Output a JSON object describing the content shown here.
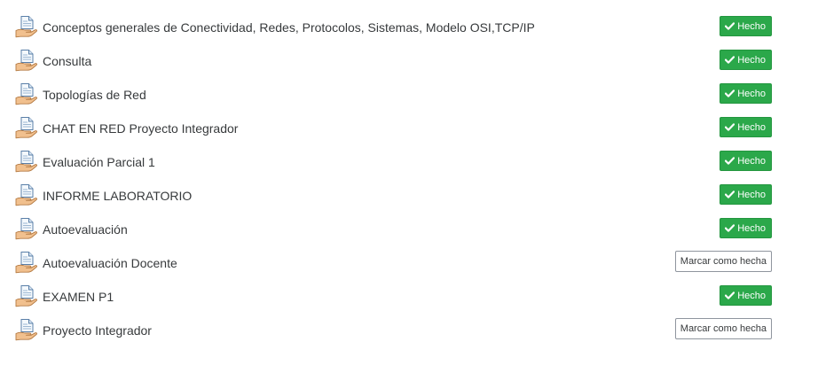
{
  "activities": [
    {
      "title": "Conceptos generales de Conectividad, Redes, Protocolos, Sistemas, Modelo OSI,TCP/IP",
      "status": "done",
      "status_label": "Hecho",
      "icon": "page-icon"
    },
    {
      "title": "Consulta",
      "status": "done",
      "status_label": "Hecho",
      "icon": "page-icon"
    },
    {
      "title": "Topologías de Red",
      "status": "done",
      "status_label": "Hecho",
      "icon": "page-icon"
    },
    {
      "title": "CHAT EN RED Proyecto Integrador",
      "status": "done",
      "status_label": "Hecho",
      "icon": "page-icon"
    },
    {
      "title": "Evaluación Parcial 1",
      "status": "done",
      "status_label": "Hecho",
      "icon": "page-icon"
    },
    {
      "title": "INFORME LABORATORIO",
      "status": "done",
      "status_label": "Hecho",
      "icon": "page-icon"
    },
    {
      "title": "Autoevaluación",
      "status": "done",
      "status_label": "Hecho",
      "icon": "page-icon"
    },
    {
      "title": "Autoevaluación Docente",
      "status": "pending",
      "status_label": "Marcar como hecha",
      "icon": "page-icon"
    },
    {
      "title": "EXAMEN P1",
      "status": "done",
      "status_label": "Hecho",
      "icon": "page-icon"
    },
    {
      "title": "Proyecto Integrador",
      "status": "pending",
      "status_label": "Marcar como hecha",
      "icon": "page-icon"
    }
  ],
  "colors": {
    "done_bg": "#2ba84a",
    "text": "#373a3c",
    "button_border": "#8f959e"
  }
}
